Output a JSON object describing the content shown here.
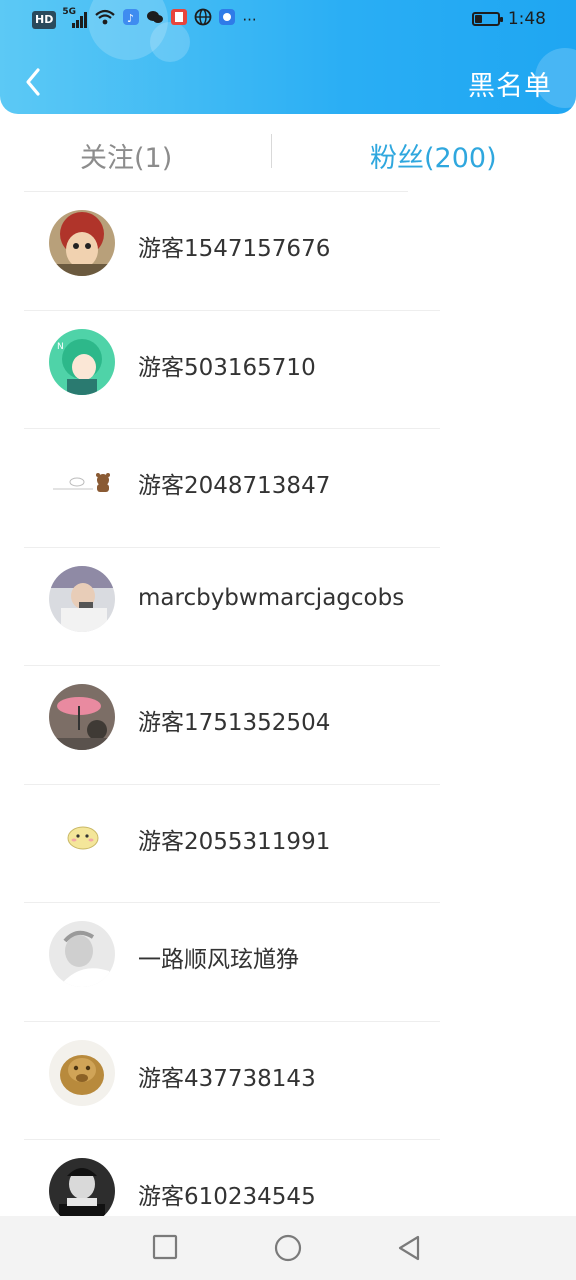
{
  "status_bar": {
    "hd_label": "HD",
    "signal_label": "5G",
    "time": "1:48",
    "more": "···",
    "battery_level": 0.3
  },
  "header": {
    "back_icon": "chevron-left-icon",
    "blacklist_label": "黑名单",
    "gradient_colors": [
      "#5cc9f5",
      "#1fa6f2"
    ]
  },
  "tabs": [
    {
      "label": "关注(1)",
      "active": false,
      "color": "#8c8c8c"
    },
    {
      "label": "粉丝(200)",
      "active": true,
      "color": "#2fa7de"
    }
  ],
  "fans": [
    {
      "name": "游客1547157676",
      "avatar": "anime-red-hair-avatar"
    },
    {
      "name": "游客503165710",
      "avatar": "anime-green-hair-avatar"
    },
    {
      "name": "游客2048713847",
      "avatar": "brown-bear-sticker-avatar"
    },
    {
      "name": "marcbybwmarcjagcobs",
      "avatar": "person-photo-avatar"
    },
    {
      "name": "游客1751352504",
      "avatar": "umbrella-photo-avatar"
    },
    {
      "name": "游客2055311991",
      "avatar": "hamster-sticker-avatar"
    },
    {
      "name": "一路顺风玹馗狰",
      "avatar": "grey-photo-avatar"
    },
    {
      "name": "游客437738143",
      "avatar": "golden-lion-statue-avatar"
    },
    {
      "name": "游客610234545",
      "avatar": "monochrome-person-avatar"
    }
  ],
  "nav_bar": {
    "recent_icon": "square-icon",
    "home_icon": "circle-icon",
    "back_icon": "triangle-back-icon"
  }
}
